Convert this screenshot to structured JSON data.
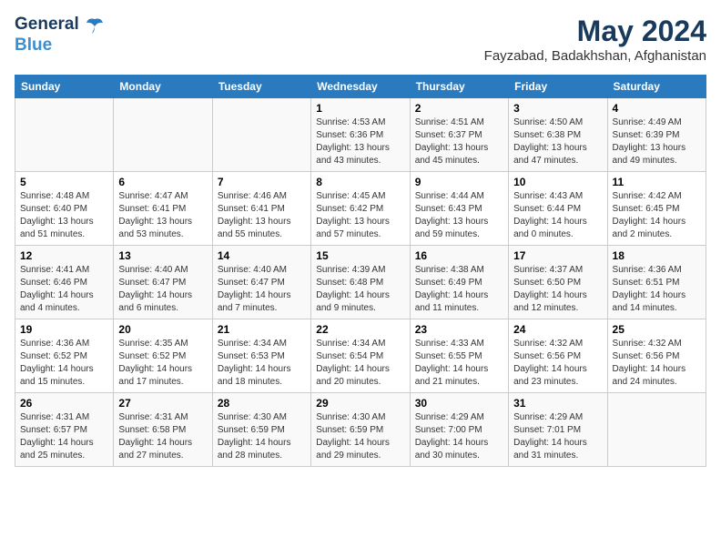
{
  "header": {
    "logo_general": "General",
    "logo_blue": "Blue",
    "title": "May 2024",
    "subtitle": "Fayzabad, Badakhshan, Afghanistan"
  },
  "calendar": {
    "days_of_week": [
      "Sunday",
      "Monday",
      "Tuesday",
      "Wednesday",
      "Thursday",
      "Friday",
      "Saturday"
    ],
    "weeks": [
      [
        {
          "day": null,
          "info": null
        },
        {
          "day": null,
          "info": null
        },
        {
          "day": null,
          "info": null
        },
        {
          "day": "1",
          "info": "Sunrise: 4:53 AM\nSunset: 6:36 PM\nDaylight: 13 hours\nand 43 minutes."
        },
        {
          "day": "2",
          "info": "Sunrise: 4:51 AM\nSunset: 6:37 PM\nDaylight: 13 hours\nand 45 minutes."
        },
        {
          "day": "3",
          "info": "Sunrise: 4:50 AM\nSunset: 6:38 PM\nDaylight: 13 hours\nand 47 minutes."
        },
        {
          "day": "4",
          "info": "Sunrise: 4:49 AM\nSunset: 6:39 PM\nDaylight: 13 hours\nand 49 minutes."
        }
      ],
      [
        {
          "day": "5",
          "info": "Sunrise: 4:48 AM\nSunset: 6:40 PM\nDaylight: 13 hours\nand 51 minutes."
        },
        {
          "day": "6",
          "info": "Sunrise: 4:47 AM\nSunset: 6:41 PM\nDaylight: 13 hours\nand 53 minutes."
        },
        {
          "day": "7",
          "info": "Sunrise: 4:46 AM\nSunset: 6:41 PM\nDaylight: 13 hours\nand 55 minutes."
        },
        {
          "day": "8",
          "info": "Sunrise: 4:45 AM\nSunset: 6:42 PM\nDaylight: 13 hours\nand 57 minutes."
        },
        {
          "day": "9",
          "info": "Sunrise: 4:44 AM\nSunset: 6:43 PM\nDaylight: 13 hours\nand 59 minutes."
        },
        {
          "day": "10",
          "info": "Sunrise: 4:43 AM\nSunset: 6:44 PM\nDaylight: 14 hours\nand 0 minutes."
        },
        {
          "day": "11",
          "info": "Sunrise: 4:42 AM\nSunset: 6:45 PM\nDaylight: 14 hours\nand 2 minutes."
        }
      ],
      [
        {
          "day": "12",
          "info": "Sunrise: 4:41 AM\nSunset: 6:46 PM\nDaylight: 14 hours\nand 4 minutes."
        },
        {
          "day": "13",
          "info": "Sunrise: 4:40 AM\nSunset: 6:47 PM\nDaylight: 14 hours\nand 6 minutes."
        },
        {
          "day": "14",
          "info": "Sunrise: 4:40 AM\nSunset: 6:47 PM\nDaylight: 14 hours\nand 7 minutes."
        },
        {
          "day": "15",
          "info": "Sunrise: 4:39 AM\nSunset: 6:48 PM\nDaylight: 14 hours\nand 9 minutes."
        },
        {
          "day": "16",
          "info": "Sunrise: 4:38 AM\nSunset: 6:49 PM\nDaylight: 14 hours\nand 11 minutes."
        },
        {
          "day": "17",
          "info": "Sunrise: 4:37 AM\nSunset: 6:50 PM\nDaylight: 14 hours\nand 12 minutes."
        },
        {
          "day": "18",
          "info": "Sunrise: 4:36 AM\nSunset: 6:51 PM\nDaylight: 14 hours\nand 14 minutes."
        }
      ],
      [
        {
          "day": "19",
          "info": "Sunrise: 4:36 AM\nSunset: 6:52 PM\nDaylight: 14 hours\nand 15 minutes."
        },
        {
          "day": "20",
          "info": "Sunrise: 4:35 AM\nSunset: 6:52 PM\nDaylight: 14 hours\nand 17 minutes."
        },
        {
          "day": "21",
          "info": "Sunrise: 4:34 AM\nSunset: 6:53 PM\nDaylight: 14 hours\nand 18 minutes."
        },
        {
          "day": "22",
          "info": "Sunrise: 4:34 AM\nSunset: 6:54 PM\nDaylight: 14 hours\nand 20 minutes."
        },
        {
          "day": "23",
          "info": "Sunrise: 4:33 AM\nSunset: 6:55 PM\nDaylight: 14 hours\nand 21 minutes."
        },
        {
          "day": "24",
          "info": "Sunrise: 4:32 AM\nSunset: 6:56 PM\nDaylight: 14 hours\nand 23 minutes."
        },
        {
          "day": "25",
          "info": "Sunrise: 4:32 AM\nSunset: 6:56 PM\nDaylight: 14 hours\nand 24 minutes."
        }
      ],
      [
        {
          "day": "26",
          "info": "Sunrise: 4:31 AM\nSunset: 6:57 PM\nDaylight: 14 hours\nand 25 minutes."
        },
        {
          "day": "27",
          "info": "Sunrise: 4:31 AM\nSunset: 6:58 PM\nDaylight: 14 hours\nand 27 minutes."
        },
        {
          "day": "28",
          "info": "Sunrise: 4:30 AM\nSunset: 6:59 PM\nDaylight: 14 hours\nand 28 minutes."
        },
        {
          "day": "29",
          "info": "Sunrise: 4:30 AM\nSunset: 6:59 PM\nDaylight: 14 hours\nand 29 minutes."
        },
        {
          "day": "30",
          "info": "Sunrise: 4:29 AM\nSunset: 7:00 PM\nDaylight: 14 hours\nand 30 minutes."
        },
        {
          "day": "31",
          "info": "Sunrise: 4:29 AM\nSunset: 7:01 PM\nDaylight: 14 hours\nand 31 minutes."
        },
        {
          "day": null,
          "info": null
        }
      ]
    ]
  }
}
